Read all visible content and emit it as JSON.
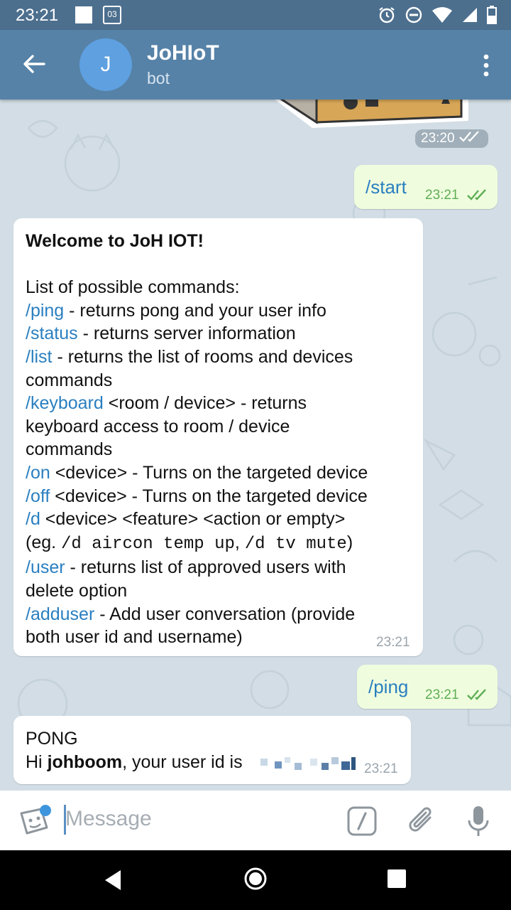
{
  "status_bar": {
    "time": "23:21",
    "calendar_day": "03"
  },
  "header": {
    "avatar_letter": "J",
    "title": "JoHIoT",
    "subtitle": "bot"
  },
  "messages": {
    "sticker_time": "23:20",
    "start": {
      "text": "/start",
      "time": "23:21"
    },
    "welcome": {
      "title": "Welcome to JoH IOT!",
      "intro": "List of possible commands:",
      "ping_cmd": "/ping",
      "ping_desc": " - returns pong and your user info",
      "status_cmd": "/status",
      "status_desc": " - returns server information",
      "list_cmd": "/list",
      "list_desc_1": " - returns the list of rooms and devices",
      "list_desc_2": "commands",
      "keyboard_cmd": "/keyboard",
      "keyboard_desc_1": " <room / device> - returns",
      "keyboard_desc_2": "keyboard access to room / device",
      "keyboard_desc_3": "commands",
      "on_cmd": "/on",
      "on_desc": " <device> - Turns on the targeted device",
      "off_cmd": "/off",
      "off_desc": " <device> - Turns on the targeted device",
      "d_cmd": "/d",
      "d_desc": " <device> <feature> <action or empty>",
      "eg_prefix": "(eg. ",
      "eg_code_1": "/d aircon temp up",
      "eg_sep": ", ",
      "eg_code_2": "/d tv mute",
      "eg_suffix": ")",
      "user_cmd": "/user",
      "user_desc_1": " - returns list of approved users with",
      "user_desc_2": "delete option",
      "adduser_cmd": "/adduser",
      "adduser_desc_1": " - Add user conversation (provide",
      "adduser_desc_2": "both user id and username)",
      "time": "23:21"
    },
    "ping": {
      "text": "/ping",
      "time": "23:21"
    },
    "pong": {
      "line1": "PONG",
      "hi": "Hi ",
      "username": "johboom",
      "rest": ", your user id is ",
      "time": "23:21"
    }
  },
  "input": {
    "placeholder": "Message"
  },
  "colors": {
    "header": "#5682a7",
    "status_bar": "#4d6f8e",
    "command_link": "#2a7fc0",
    "outgoing_bubble": "#effdde",
    "read_check": "#5fae56"
  }
}
